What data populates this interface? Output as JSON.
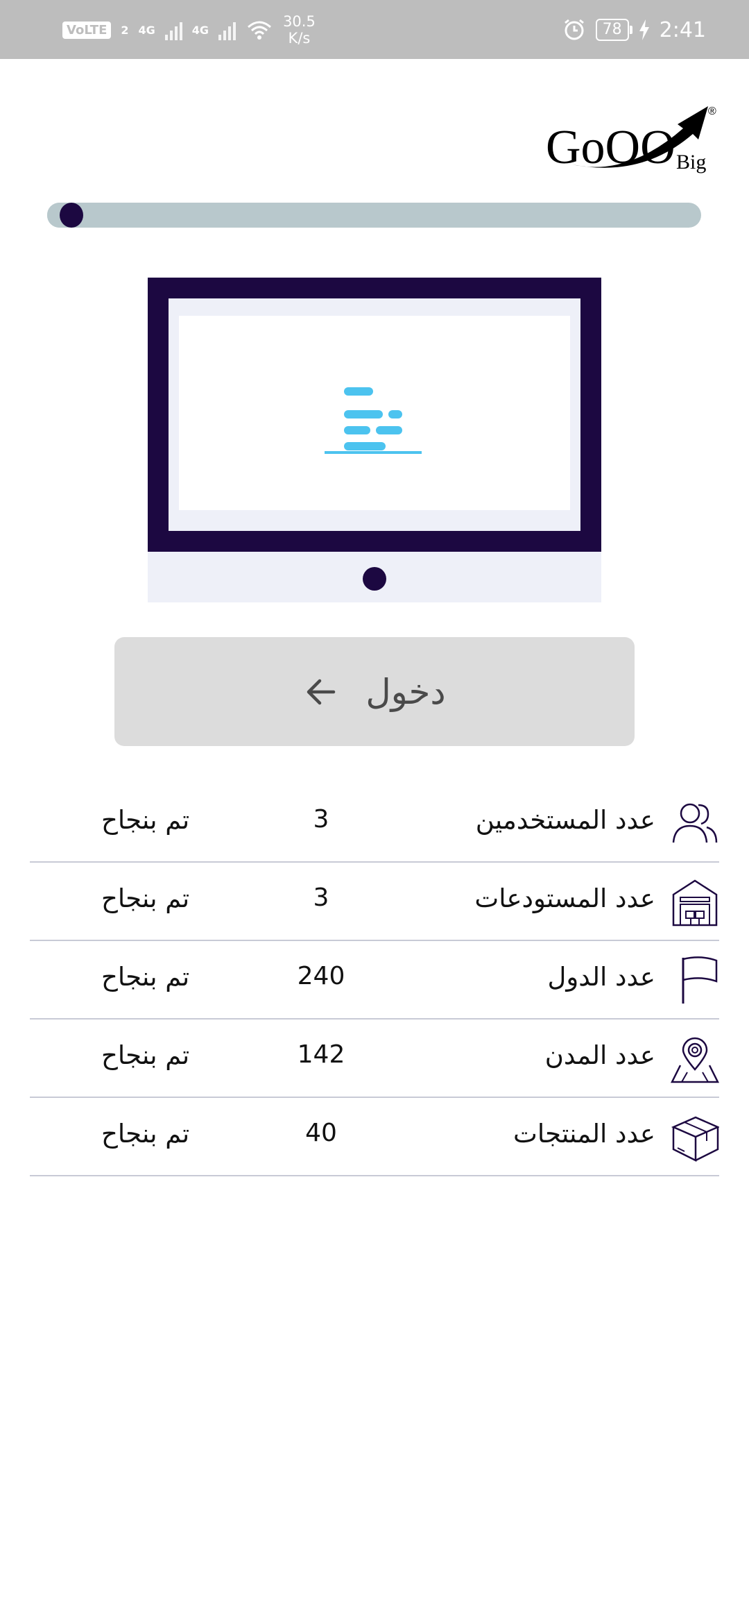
{
  "status_bar": {
    "volte": "VoLTE",
    "sim": "2",
    "net1": "4G",
    "net2": "4G",
    "speed_value": "30.5",
    "speed_unit": "K/s",
    "battery": "78",
    "time": "2:41"
  },
  "logo": {
    "text": "GoOO",
    "sub": "Big",
    "registered": "®"
  },
  "progress": {
    "value": 0.02
  },
  "login": {
    "label": "دخول"
  },
  "stats": [
    {
      "icon": "users-icon",
      "label": "عدد المستخدمين",
      "count": "3",
      "status": "تم بنجاح"
    },
    {
      "icon": "warehouse-icon",
      "label": "عدد المستودعات",
      "count": "3",
      "status": "تم بنجاح"
    },
    {
      "icon": "flag-icon",
      "label": "عدد الدول",
      "count": "240",
      "status": "تم بنجاح"
    },
    {
      "icon": "map-pin-icon",
      "label": "عدد المدن",
      "count": "142",
      "status": "تم بنجاح"
    },
    {
      "icon": "box-icon",
      "label": "عدد المنتجات",
      "count": "40",
      "status": "تم بنجاح"
    }
  ],
  "colors": {
    "accent": "#1c0841",
    "track": "#b8c8cc",
    "button_bg": "#dcdcdc",
    "loader_blue": "#4cc3ef"
  }
}
